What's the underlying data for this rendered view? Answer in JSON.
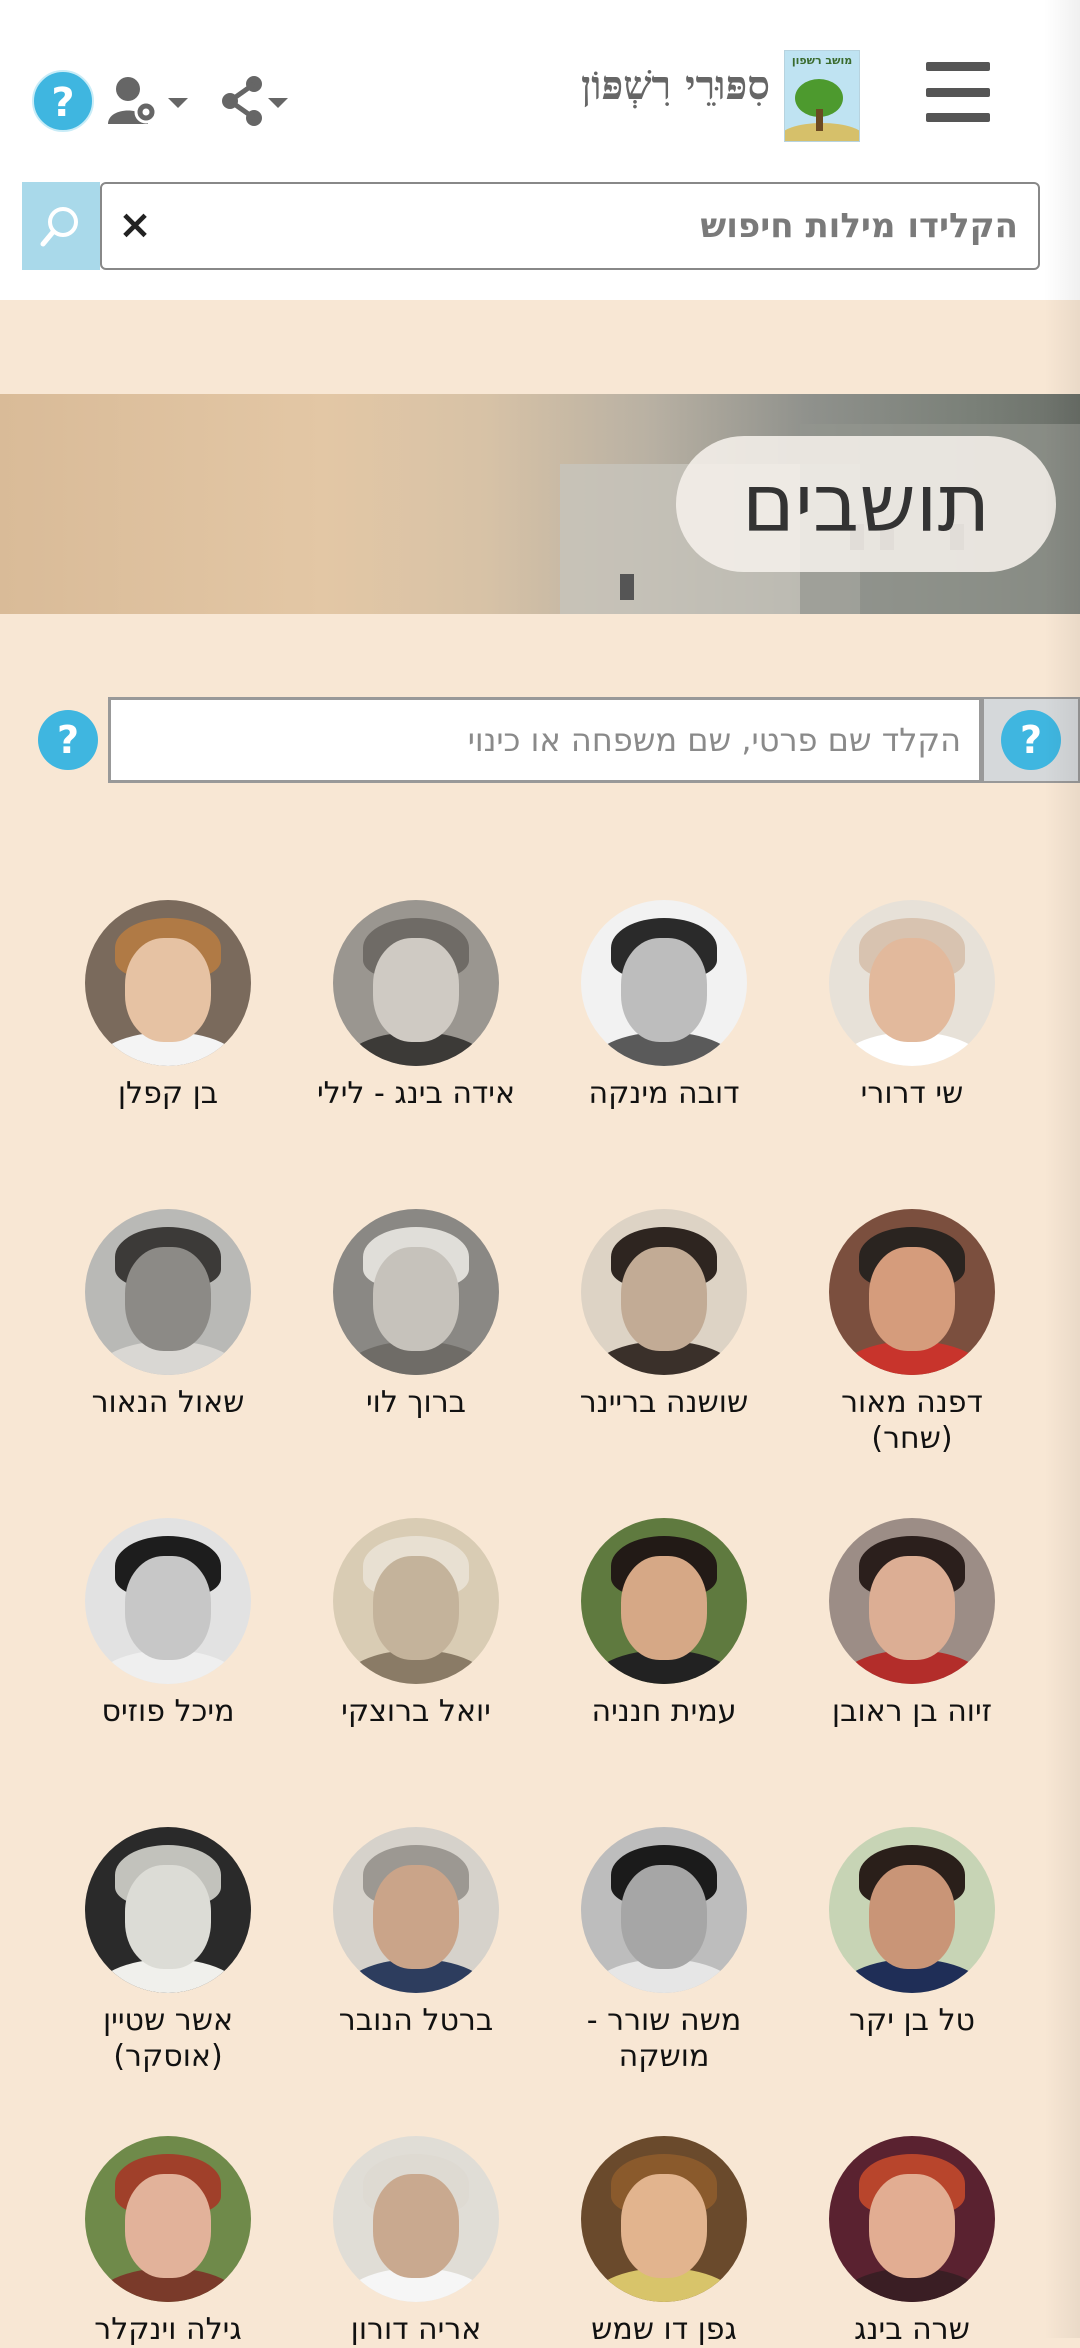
{
  "header": {
    "logo_text": "מושב רשפון",
    "logo_subtext": "סיפורי",
    "site_title": "סִפּוּרֵי רִשְׁפּוֹן",
    "help_label": "?"
  },
  "search": {
    "placeholder": "הקלידו מילות חיפוש",
    "clear_label": "×"
  },
  "banner": {
    "title": "תושבים"
  },
  "residents_search": {
    "placeholder": "הקלד שם פרטי, שם משפחה או כינוי",
    "help_label": "?"
  },
  "people": [
    {
      "name": "שי דרורי",
      "bg": "#e7e1d8",
      "face": "#e2b99c",
      "hair": "#d8c3b0",
      "clothes": "#ffffff"
    },
    {
      "name": "דובה מינקה",
      "bg": "#f2f2f2",
      "face": "#bdbdbd",
      "hair": "#2a2a2a",
      "clothes": "#5a5a5a"
    },
    {
      "name": "אידה בינג - לילי",
      "bg": "#9a9690",
      "face": "#cfcac3",
      "hair": "#6f6b66",
      "clothes": "#3c3a37"
    },
    {
      "name": "בן קפלן",
      "bg": "#7a6a5c",
      "face": "#e6c2a3",
      "hair": "#b07a45",
      "clothes": "#f4f4f4"
    },
    {
      "name": "דפנה מאור (שחר)",
      "bg": "#7b4f3e",
      "face": "#d59c7c",
      "hair": "#2a2420",
      "clothes": "#c8342c"
    },
    {
      "name": "שושנה בריינר",
      "bg": "#ddd3c5",
      "face": "#c2ab95",
      "hair": "#2e2520",
      "clothes": "#3a302a"
    },
    {
      "name": "ברוך לוי",
      "bg": "#8a8884",
      "face": "#c6c2bb",
      "hair": "#e0ded9",
      "clothes": "#6f6c67"
    },
    {
      "name": "שאול הנאור",
      "bg": "#b9b9b6",
      "face": "#8c8a86",
      "hair": "#3c3a38",
      "clothes": "#d9d7d3"
    },
    {
      "name": "זיוה בן ראובן",
      "bg": "#9c8d86",
      "face": "#dcae94",
      "hair": "#2b1f1c",
      "clothes": "#b32d2a"
    },
    {
      "name": "עמית חנניה",
      "bg": "#5f7a3f",
      "face": "#d6a886",
      "hair": "#221a16",
      "clothes": "#222222"
    },
    {
      "name": "יואל ברוצקי",
      "bg": "#d9ccb4",
      "face": "#c4b39b",
      "hair": "#e8e0d2",
      "clothes": "#8a7b66"
    },
    {
      "name": "מיכל פוזיס",
      "bg": "#e2e2e2",
      "face": "#c7c7c7",
      "hair": "#1d1d1d",
      "clothes": "#efefef"
    },
    {
      "name": "טל בן יקר",
      "bg": "#c7d4b5",
      "face": "#c99577",
      "hair": "#2a1f1a",
      "clothes": "#1f2e57"
    },
    {
      "name": "משה שורר - מושקה",
      "bg": "#bdbdbd",
      "face": "#a6a6a6",
      "hair": "#1b1b1b",
      "clothes": "#e6e6e6"
    },
    {
      "name": "ברטל הנובר",
      "bg": "#d6d2cb",
      "face": "#caa489",
      "hair": "#9c9892",
      "clothes": "#2d3d5e"
    },
    {
      "name": "אשר שטיין (אוסקר)",
      "bg": "#2a2a2a",
      "face": "#dcdcd6",
      "hair": "#c2c2bc",
      "clothes": "#f0f0ec"
    },
    {
      "name": "שרה בינג",
      "bg": "#5a2230",
      "face": "#e2ad92",
      "hair": "#b8452c",
      "clothes": "#3a1e24"
    },
    {
      "name": "גפן דו שמש",
      "bg": "#6a4a2c",
      "face": "#e2b48e",
      "hair": "#8a5a2c",
      "clothes": "#d8c46a"
    },
    {
      "name": "אריה דורון",
      "bg": "#e0ddd6",
      "face": "#c9a98f",
      "hair": "#dedad2",
      "clothes": "#f6f6f6"
    },
    {
      "name": "גילה וינקלר",
      "bg": "#6f8a4a",
      "face": "#e2b29a",
      "hair": "#a0402a",
      "clothes": "#7a3a2a"
    }
  ],
  "colors": {
    "accent": "#3fb6e0",
    "page_bg": "#f8e7d4",
    "search_btn": "#a9d9ea"
  }
}
